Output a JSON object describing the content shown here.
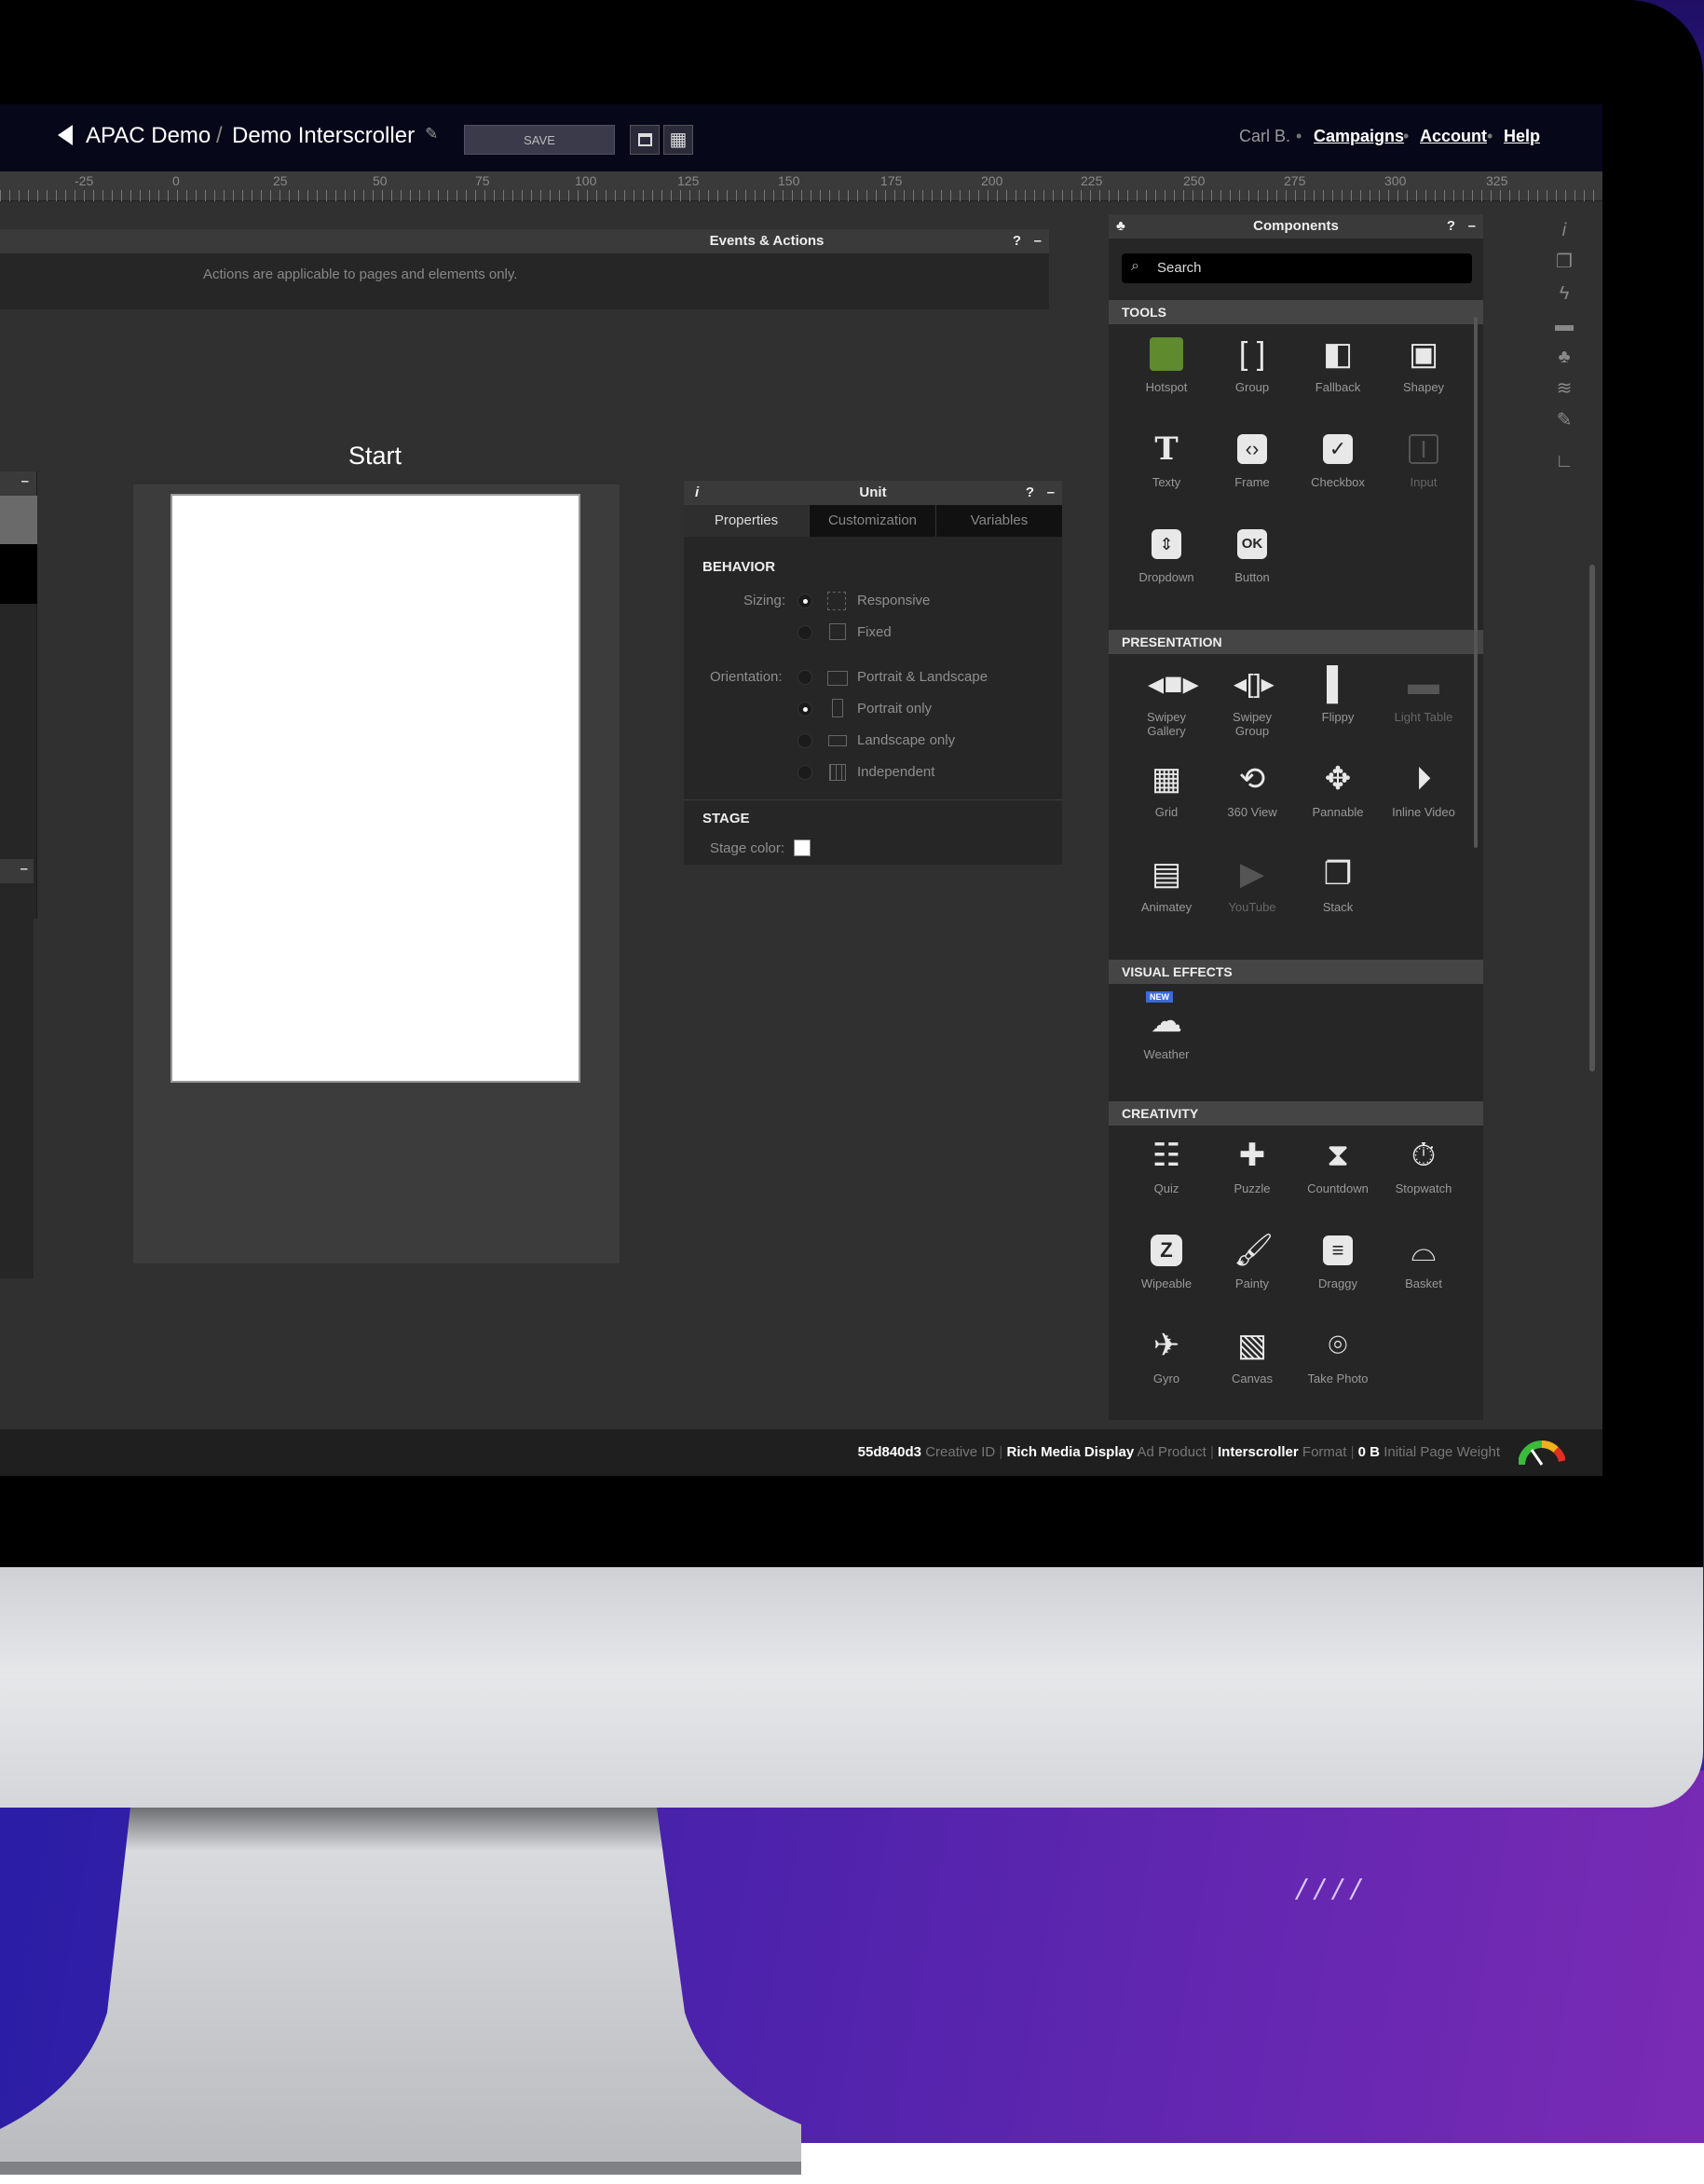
{
  "app": {
    "breadcrumb_project": "APAC Demo",
    "breadcrumb_sep": "/",
    "breadcrumb_creative": "Demo Interscroller",
    "save_label": "SAVE",
    "user": "Carl B.",
    "nav": [
      "Campaigns",
      "Account",
      "Help"
    ]
  },
  "ruler": [
    "-25",
    "0",
    "25",
    "50",
    "75",
    "100",
    "125",
    "150",
    "175",
    "200",
    "225",
    "250",
    "275",
    "300",
    "325"
  ],
  "events_panel": {
    "title": "Events & Actions",
    "help": "?",
    "minimize": "–",
    "message": "Actions are applicable to pages and elements only."
  },
  "stage": {
    "page_title": "Start"
  },
  "unit_panel": {
    "title": "Unit",
    "help": "?",
    "minimize": "–",
    "tabs": [
      "Properties",
      "Customization",
      "Variables"
    ],
    "active_tab": "Properties",
    "behavior_heading": "BEHAVIOR",
    "sizing_label": "Sizing:",
    "sizing_options": [
      "Responsive",
      "Fixed"
    ],
    "sizing_selected": "Responsive",
    "orientation_label": "Orientation:",
    "orientation_options": [
      "Portrait & Landscape",
      "Portrait only",
      "Landscape only",
      "Independent"
    ],
    "orientation_selected": "Portrait only",
    "stage_heading": "STAGE",
    "stage_color_label": "Stage color:",
    "stage_color": "#ffffff"
  },
  "components_panel": {
    "title": "Components",
    "help": "?",
    "minimize": "–",
    "search_placeholder": "Search",
    "sections": [
      {
        "name": "TOOLS",
        "items": [
          {
            "label": "Hotspot",
            "icon": "hotspot-icon"
          },
          {
            "label": "Group",
            "icon": "group-brackets-icon"
          },
          {
            "label": "Fallback",
            "icon": "fallback-icon"
          },
          {
            "label": "Shapey",
            "icon": "shapey-icon"
          },
          {
            "label": "Texty",
            "icon": "text-icon"
          },
          {
            "label": "Frame",
            "icon": "frame-code-icon"
          },
          {
            "label": "Checkbox",
            "icon": "checkbox-icon"
          },
          {
            "label": "Input",
            "icon": "input-icon"
          },
          {
            "label": "Dropdown",
            "icon": "dropdown-icon"
          },
          {
            "label": "Button",
            "icon": "ok-button-icon",
            "glyph": "OK"
          }
        ]
      },
      {
        "name": "PRESENTATION",
        "items": [
          {
            "label": "Swipey Gallery",
            "icon": "swipey-gallery-icon"
          },
          {
            "label": "Swipey Group",
            "icon": "swipey-group-icon"
          },
          {
            "label": "Flippy",
            "icon": "flippy-icon"
          },
          {
            "label": "Light Table",
            "icon": "light-table-icon"
          },
          {
            "label": "Grid",
            "icon": "grid-icon"
          },
          {
            "label": "360 View",
            "icon": "rotate-360-icon"
          },
          {
            "label": "Pannable",
            "icon": "pan-arrows-icon"
          },
          {
            "label": "Inline Video",
            "icon": "play-circle-icon"
          },
          {
            "label": "Animatey",
            "icon": "animatey-icon"
          },
          {
            "label": "YouTube",
            "icon": "youtube-icon"
          },
          {
            "label": "Stack",
            "icon": "stack-icon"
          }
        ]
      },
      {
        "name": "VISUAL EFFECTS",
        "items": [
          {
            "label": "Weather",
            "icon": "weather-icon",
            "badge": "NEW"
          }
        ]
      },
      {
        "name": "CREATIVITY",
        "items": [
          {
            "label": "Quiz",
            "icon": "quiz-icon"
          },
          {
            "label": "Puzzle",
            "icon": "puzzle-icon"
          },
          {
            "label": "Countdown",
            "icon": "hourglass-icon"
          },
          {
            "label": "Stopwatch",
            "icon": "stopwatch-icon"
          },
          {
            "label": "Wipeable",
            "icon": "wipeable-icon"
          },
          {
            "label": "Painty",
            "icon": "brush-icon"
          },
          {
            "label": "Draggy",
            "icon": "draggy-icon"
          },
          {
            "label": "Basket",
            "icon": "basket-icon"
          },
          {
            "label": "Gyro",
            "icon": "gyro-icon"
          },
          {
            "label": "Canvas",
            "icon": "canvas-icon"
          },
          {
            "label": "Take Photo",
            "icon": "camera-icon"
          }
        ]
      }
    ]
  },
  "status": {
    "creative_id": "55d840d3",
    "creative_id_label": "Creative ID",
    "ad_product": "Rich Media Display",
    "ad_product_label": "Ad Product",
    "format": "Interscroller",
    "format_label": "Format",
    "weight": "0 B",
    "weight_label": "Initial Page Weight"
  },
  "decor": {
    "slashes": "////"
  }
}
